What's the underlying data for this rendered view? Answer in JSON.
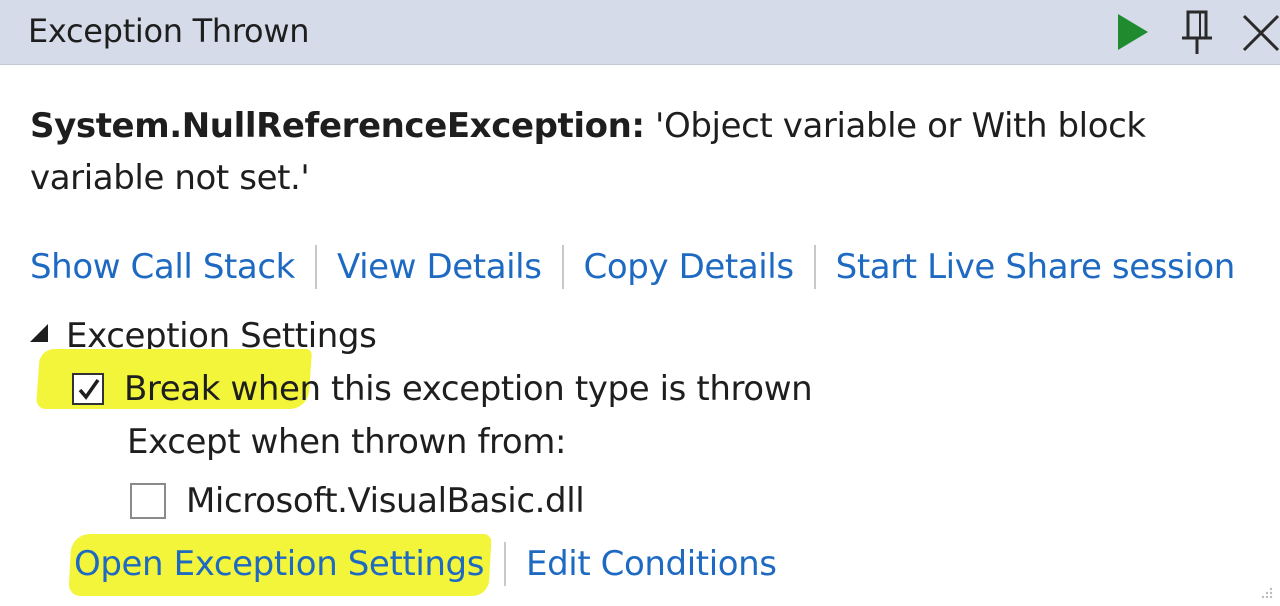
{
  "window": {
    "title": "Exception Thrown",
    "icons": {
      "continue": "play-icon",
      "pin": "pin-icon",
      "close": "close-icon"
    },
    "colors": {
      "continue": "#1e8b2e",
      "link": "#1e6ac3",
      "highlight": "#f2f53a",
      "titlebar": "#d6dbe9"
    }
  },
  "exception": {
    "type": "System.NullReferenceException:",
    "message": " 'Object variable or With block variable not set.'"
  },
  "actions": [
    "Show Call Stack",
    "View Details",
    "Copy Details",
    "Start Live Share session"
  ],
  "settings": {
    "heading": "Exception Settings",
    "break_label": "Break when this exception type is thrown",
    "break_checked": true,
    "except_label": "Except when thrown from:",
    "module_label": "Microsoft.VisualBasic.dll",
    "module_checked": false,
    "open_settings": "Open Exception Settings",
    "edit_conditions": "Edit Conditions"
  }
}
